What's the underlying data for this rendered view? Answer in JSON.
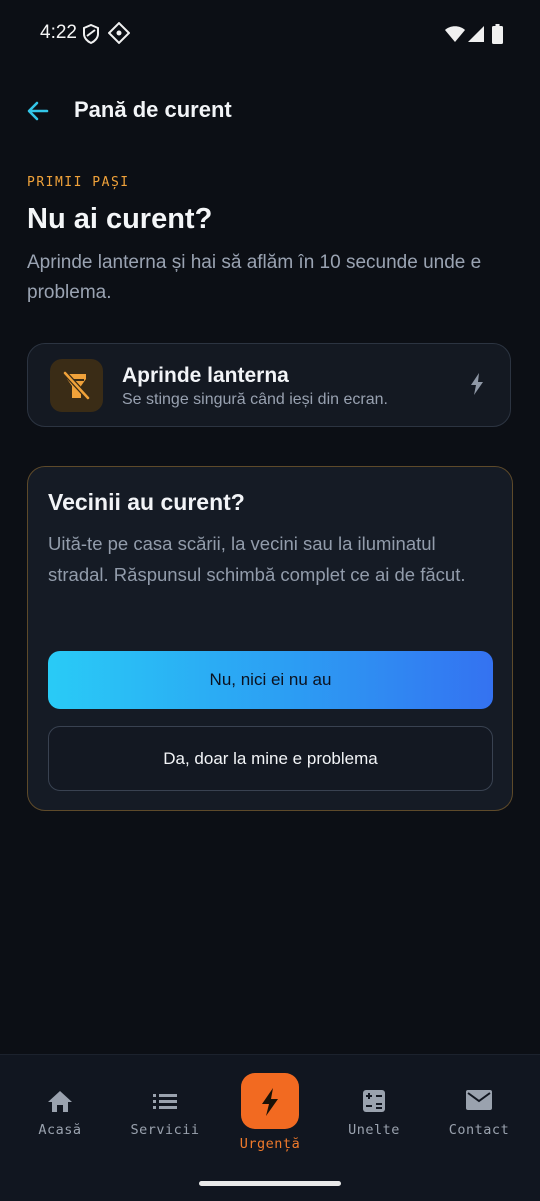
{
  "status_bar": {
    "time": "4:22"
  },
  "top_bar": {
    "title": "Pană de curent"
  },
  "eyebrow": "PRIMII PAȘI",
  "heading": "Nu ai curent?",
  "intro": "Aprinde lanterna și hai să aflăm în 10 secunde unde e problema.",
  "torch_card": {
    "title": "Aprinde lanterna",
    "subtitle": "Se stinge singură când ieși din ecran.",
    "icon": "flashlight-off-icon"
  },
  "question_card": {
    "title": "Vecinii au curent?",
    "text": "Uită-te pe casa scării, la vecini sau la iluminatul stradal. Răspunsul schimbă complet ce ai de făcut.",
    "primary_label": "Nu, nici ei nu au",
    "secondary_label": "Da, doar la mine e problema"
  },
  "bottom_nav": {
    "items": [
      {
        "label": "Acasă",
        "icon": "home-icon"
      },
      {
        "label": "Servicii",
        "icon": "list-icon"
      },
      {
        "label": "Urgență",
        "icon": "bolt-icon",
        "active": true
      },
      {
        "label": "Unelte",
        "icon": "calculator-icon"
      },
      {
        "label": "Contact",
        "icon": "mail-icon"
      }
    ]
  },
  "colors": {
    "background": "#0c0f15",
    "accent_orange": "#f26a21",
    "eyebrow": "#f0a23a",
    "gradient_start": "#29cbf6",
    "gradient_end": "#3472f1"
  }
}
